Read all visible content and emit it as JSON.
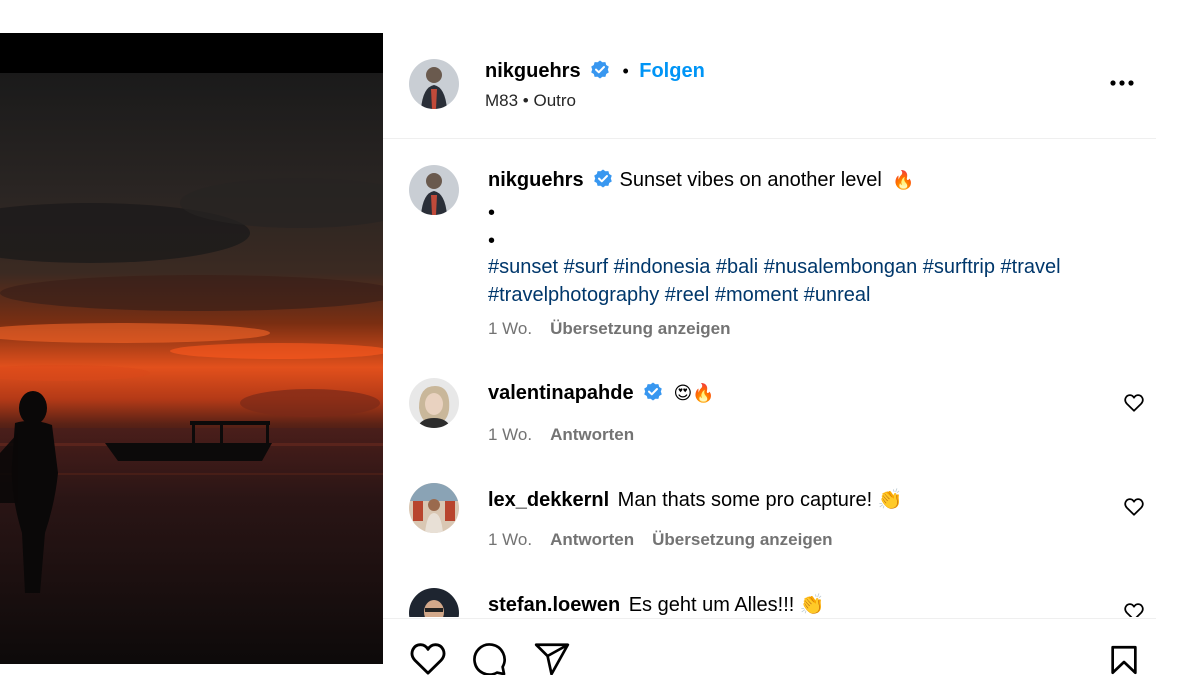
{
  "post": {
    "author": "nikguehrs",
    "follow_label": "Folgen",
    "separator": "•",
    "audio": "M83 • Outro",
    "caption": "Sunset vibes on another level",
    "caption_dots": [
      "•",
      "•"
    ],
    "hashtags_line1": "#sunset #surf #indonesia #bali #nusalembongan #surftrip #travel",
    "hashtags_line2": "#travelphotography #reel #moment #unreal",
    "time": "1 Wo.",
    "translate_label": "Übersetzung anzeigen"
  },
  "comments": [
    {
      "user": "valentinapahde",
      "verified": true,
      "text": "😍🔥",
      "time": "1 Wo.",
      "reply": "Antworten",
      "translate": ""
    },
    {
      "user": "lex_dekkernl",
      "verified": false,
      "text": "Man thats some pro capture! 👏",
      "time": "1 Wo.",
      "reply": "Antworten",
      "translate": "Übersetzung anzeigen"
    },
    {
      "user": "stefan.loewen",
      "verified": false,
      "text": "Es geht um Alles!!! 👏",
      "time": "",
      "reply": "",
      "translate": ""
    }
  ],
  "icons": {
    "verified": "verified-badge-icon",
    "fire": "fire-emoji",
    "more": "more-options-icon",
    "like": "heart-icon",
    "comment": "comment-icon",
    "share": "share-icon",
    "save": "bookmark-icon"
  },
  "colors": {
    "accent": "#0095f6",
    "verified": "#3897f0",
    "hashtag": "#00376b",
    "muted": "#737373"
  }
}
